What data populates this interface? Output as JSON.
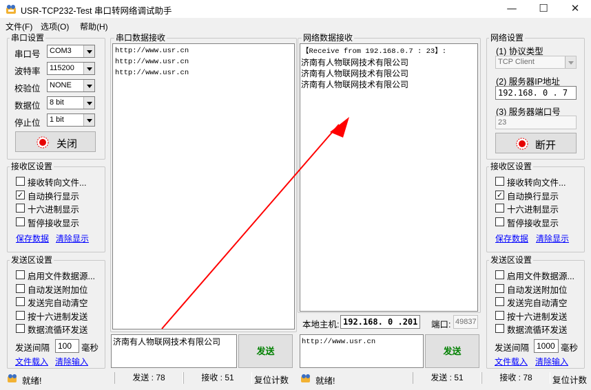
{
  "window": {
    "title": "USR-TCP232-Test 串口转网络调试助手",
    "minimize_icon": "minimize-icon",
    "maximize_icon": "maximize-icon",
    "close_icon": "close-icon"
  },
  "menu": [
    "文件(F)",
    "选项(O)",
    "帮助(H)"
  ],
  "serial_settings": {
    "title": "串口设置",
    "port_label": "串口号",
    "port_value": "COM3",
    "baud_label": "波特率",
    "baud_value": "115200",
    "parity_label": "校验位",
    "parity_value": "NONE",
    "databits_label": "数据位",
    "databits_value": "8 bit",
    "stopbits_label": "停止位",
    "stopbits_value": "1 bit",
    "close_button": "关闭",
    "status_icon": "red-indicator-icon"
  },
  "left_receive": {
    "title": "接收区设置",
    "options": [
      {
        "label": "接收转向文件...",
        "checked": false
      },
      {
        "label": "自动换行显示",
        "checked": true
      },
      {
        "label": "十六进制显示",
        "checked": false
      },
      {
        "label": "暂停接收显示",
        "checked": false
      }
    ],
    "save_link": "保存数据",
    "clear_link": "清除显示"
  },
  "left_send": {
    "title": "发送区设置",
    "options": [
      {
        "label": "启用文件数据源...",
        "checked": false
      },
      {
        "label": "自动发送附加位",
        "checked": false
      },
      {
        "label": "发送完自动清空",
        "checked": false
      },
      {
        "label": "按十六进制发送",
        "checked": false
      },
      {
        "label": "数据流循环发送",
        "checked": false
      }
    ],
    "interval_label": "发送间隔",
    "interval_value": "100",
    "interval_unit": "毫秒",
    "file_load_link": "文件载入",
    "clear_input_link": "清除输入"
  },
  "serial_receive": {
    "title": "串口数据接收",
    "lines": [
      "http://www.usr.cn",
      "http://www.usr.cn",
      "http://www.usr.cn"
    ]
  },
  "serial_send": {
    "text": "济南有人物联网技术有限公司",
    "button": "发送"
  },
  "net_receive": {
    "title": "网络数据接收",
    "header_line": "【Receive from 192.168.0.7 : 23】:",
    "lines": [
      "济南有人物联网技术有限公司",
      "济南有人物联网技术有限公司",
      "济南有人物联网技术有限公司"
    ]
  },
  "local_host": {
    "label": "本地主机:",
    "ip": "192.168. 0 .201",
    "port_label": "端口:",
    "port": "49837"
  },
  "net_send": {
    "text": "http://www.usr.cn",
    "button": "发送"
  },
  "net_settings": {
    "title": "网络设置",
    "protocol_label": "(1) 协议类型",
    "protocol_value": "TCP Client",
    "server_ip_label": "(2) 服务器IP地址",
    "server_ip": "192.168. 0 . 7",
    "server_port_label": "(3) 服务器端口号",
    "server_port": "23",
    "disconnect_button": "断开",
    "status_icon": "red-indicator-icon"
  },
  "right_receive": {
    "title": "接收区设置",
    "options": [
      {
        "label": "接收转向文件...",
        "checked": false
      },
      {
        "label": "自动换行显示",
        "checked": true
      },
      {
        "label": "十六进制显示",
        "checked": false
      },
      {
        "label": "暂停接收显示",
        "checked": false
      }
    ],
    "save_link": "保存数据",
    "clear_link": "清除显示"
  },
  "right_send": {
    "title": "发送区设置",
    "options": [
      {
        "label": "启用文件数据源...",
        "checked": false
      },
      {
        "label": "自动发送附加位",
        "checked": false
      },
      {
        "label": "发送完自动清空",
        "checked": false
      },
      {
        "label": "按十六进制发送",
        "checked": false
      },
      {
        "label": "数据流循环发送",
        "checked": false
      }
    ],
    "interval_label": "发送间隔",
    "interval_value": "1000",
    "interval_unit": "毫秒",
    "file_load_link": "文件载入",
    "clear_input_link": "清除输入"
  },
  "status_left": {
    "ready": "就绪!",
    "sent": "发送 : 78",
    "received": "接收 : 51",
    "reset": "复位计数"
  },
  "status_right": {
    "ready": "就绪!",
    "sent": "发送 : 51",
    "received": "接收 : 78",
    "reset": "复位计数"
  },
  "annotation": {
    "arrow_color": "#ff0000"
  }
}
